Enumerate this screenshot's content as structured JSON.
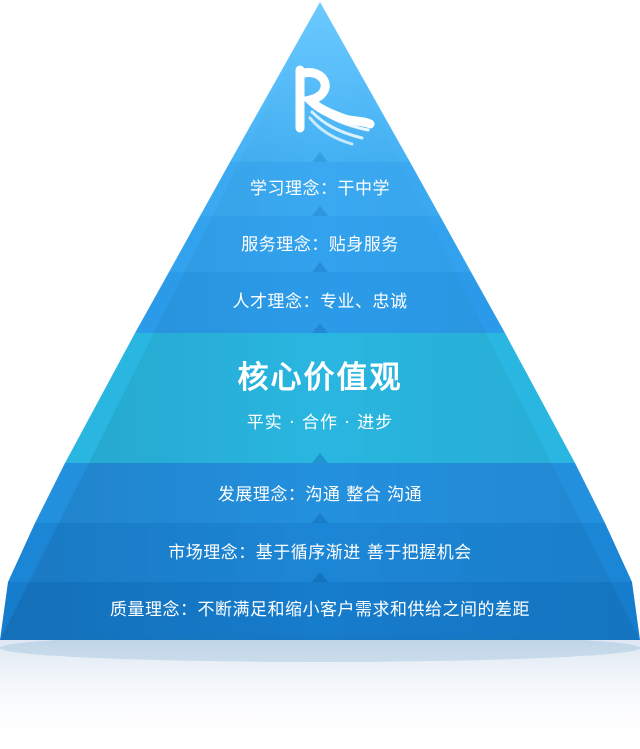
{
  "pyramid": {
    "logo_letter": "R",
    "upper_tiers": [
      {
        "label": "学习理念：干中学",
        "color": "#3aa9f1"
      },
      {
        "label": "服务理念：贴身服务",
        "color": "#32a2ee"
      },
      {
        "label": "人才理念：专业、忠诚",
        "color": "#2b9be9"
      }
    ],
    "core": {
      "title": "核心价值观",
      "subtitle": "平实 · 合作 · 进步",
      "color": "#29b6e0"
    },
    "lower_tiers": [
      {
        "label": "发展理念：沟通 整合 沟通",
        "color": "#2390de"
      },
      {
        "label": "市场理念：基于循序渐进 善于把握机会",
        "color": "#1c86d6"
      },
      {
        "label": "质量理念：不断满足和缩小客户需求和供给之间的差距",
        "color": "#167ccc"
      }
    ],
    "apex_color_top": "#6ccaff",
    "apex_color_bottom": "#3faff3",
    "notch_color": "#1f6fb8"
  }
}
